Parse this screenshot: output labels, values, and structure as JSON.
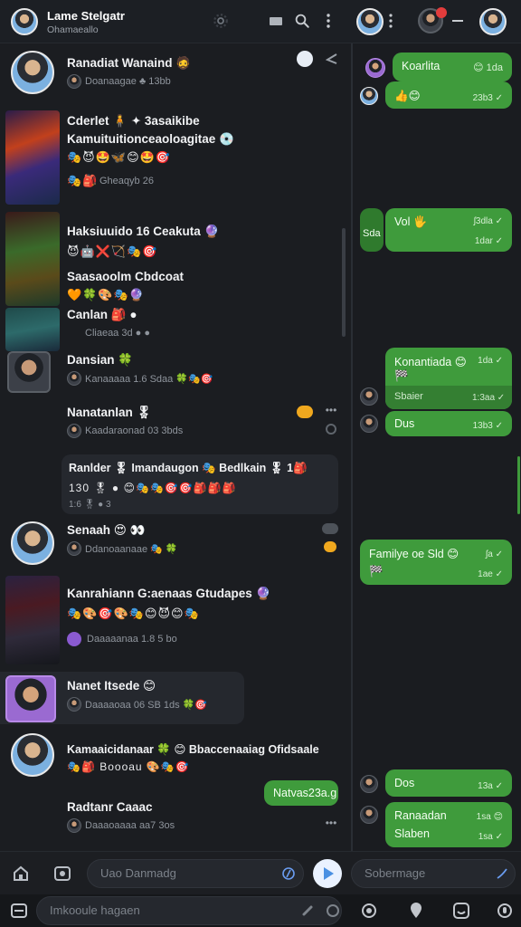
{
  "app": {
    "title": "Lame Stelgatr",
    "subtitle": "Ohamaeallo"
  },
  "chat_list": [
    {
      "name": "Ranadiat Wanaind 🧔",
      "sub": "Doanaagae ♣ 13bb",
      "emojis": ""
    },
    {
      "name": "Cderlet 🧍 ✦ 3asaikibe",
      "line2": "Kamuituitionceaoloagitae 💿",
      "emojis": "🎭😈🤩🦋😊🤩🎯",
      "sub": "Gheaqyb 26"
    },
    {
      "name": "Haksiuuido 16 Ceakuta 🔮",
      "emojis": "😈🤖❌🏹🎭🎯",
      "line2": "Saasaoolm Cbdcoat",
      "emojis2": "🧡🍀🎨🎭🔮",
      "line3": "Canlan 🎒 ●",
      "sub3": "Cliaeaa 3d ● ●"
    },
    {
      "name": "Dansian 🍀",
      "sub": "Kanaaaaa 1.6 Sdaa 🍀🎭🎯"
    },
    {
      "name": "Nanatanlan 🎖",
      "sub": "Kaadaraonad 03 3bds"
    },
    {
      "name": "Ranlder 🎖 Imandaugon 🎭 Bedlkain 🎖 1🎒",
      "line2": "130 🎖 ● 😊🎭🎭🎯🎯🎒🎒🎒",
      "sub": "1:6 🎖 ● 3"
    },
    {
      "name": "Senaah 😍 👀",
      "sub": "Ddanoaanaae 🎭 🍀"
    },
    {
      "name": "Kanrahiann G:aenaas Gtudapes 🔮",
      "emojis": "🎭🎨🎯🎨🎭😊😈😊🎭",
      "sub": "Daaaaanaa 1.8 5 bo"
    },
    {
      "name": "Nanet Itsede 😊",
      "sub": "Daaaaoaa 06 SB 1ds 🍀🎯"
    },
    {
      "name": "Kamaaicidanaar 🍀 😊 Bbaccenaaiag Ofidsaale",
      "emojis": "🎭🎒 Boooau 🎨🎭🎯"
    },
    {
      "name": "Radtanr Caaac",
      "sub": "Daaaoaaaa aa7 3os"
    }
  ],
  "left_bubble": {
    "text": "Natvas23a.g"
  },
  "right_bubbles": [
    {
      "text": "Koarlita",
      "meta": "😊 1da"
    },
    {
      "text": "👍😊",
      "meta": "23b3 ✓"
    },
    {
      "text": "Vol 🖐",
      "meta": "ʃ3dla ✓",
      "meta2": "1dar ✓",
      "side": "Sda"
    },
    {
      "text": "Konantiada 😊",
      "line2": "🏁",
      "line3": "Sbaier",
      "meta": "1da ✓",
      "meta3": "1:3aa ✓"
    },
    {
      "text": "Dus",
      "meta": "13b3 ✓"
    },
    {
      "text": "Familye oe Sld 😊",
      "line2": "🏁",
      "meta": "ʃa ✓",
      "meta2": "1ae ✓"
    },
    {
      "text": "Dos",
      "meta": "13a ✓"
    },
    {
      "text": "Ranaadan",
      "line2": "Slaben",
      "meta": "1sa 😊",
      "meta2": "1sa ✓"
    }
  ],
  "input_left": {
    "placeholder": "Uao Danmadg"
  },
  "input_right": {
    "placeholder": "Sobermage"
  },
  "input_bottom": {
    "placeholder": "Imkooule hagaen"
  },
  "icons": {
    "search": "search-icon",
    "menu": "more-vertical-icon",
    "send": "send-icon"
  },
  "colors": {
    "accent_green": "#3f9b3c",
    "badge_red": "#e23c3c"
  }
}
